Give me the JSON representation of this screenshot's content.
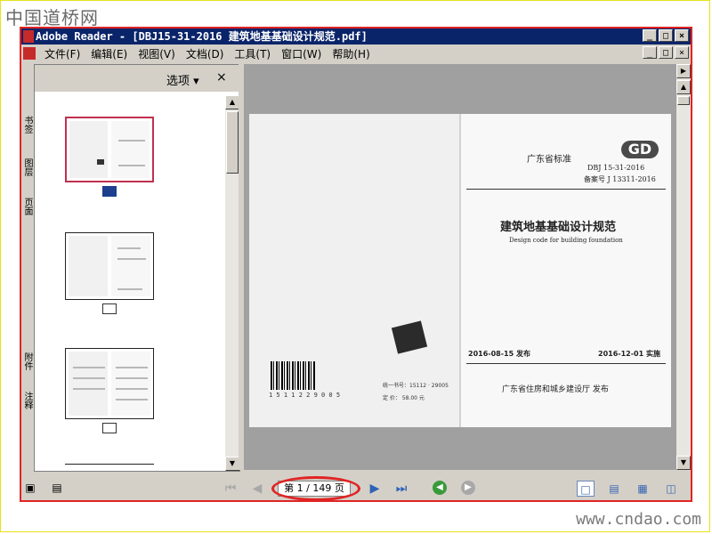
{
  "watermark": {
    "top": "中国道桥网",
    "bottom": "www.cndao.com"
  },
  "window": {
    "title": "Adobe Reader - [DBJ15-31-2016 建筑地基基础设计规范.pdf]",
    "controls": [
      "_",
      "□",
      "×"
    ],
    "doc_controls": [
      "_",
      "□",
      "×"
    ]
  },
  "menu": {
    "items": [
      "文件(F)",
      "编辑(E)",
      "视图(V)",
      "文档(D)",
      "工具(T)",
      "窗口(W)",
      "帮助(H)"
    ]
  },
  "side_tabs": [
    "书签",
    "图层",
    "页面",
    "附件",
    "注释"
  ],
  "thumb_pane": {
    "options_label": "选项 ▾",
    "close_label": "×"
  },
  "document": {
    "right_page": {
      "category": "广东省标准",
      "logo": "GD",
      "code": "DBJ  15-31-2016",
      "record_no": "备案号 J 13311-2016",
      "title_cn": "建筑地基基础设计规范",
      "title_en": "Design code for building foundation",
      "issue_date": "2016-08-15  发布",
      "impl_date": "2016-12-01  实施",
      "issuer": "广东省住房和城乡建设厅    发布"
    },
    "left_page": {
      "barcode_number": "1 5 1 1 2 2 9 0 0 5",
      "book_no": "统一书号：15112 · 29005",
      "price": "定    价：        58.00    元"
    }
  },
  "status": {
    "page_indicator": "第 1 / 149 页",
    "current_page": 1,
    "total_pages": 149
  },
  "colors": {
    "title_bar": "#0a246a",
    "annotation_red": "#e02424",
    "selected_thumb": "#c0304f",
    "frame_yellow": "#e7e21b"
  }
}
